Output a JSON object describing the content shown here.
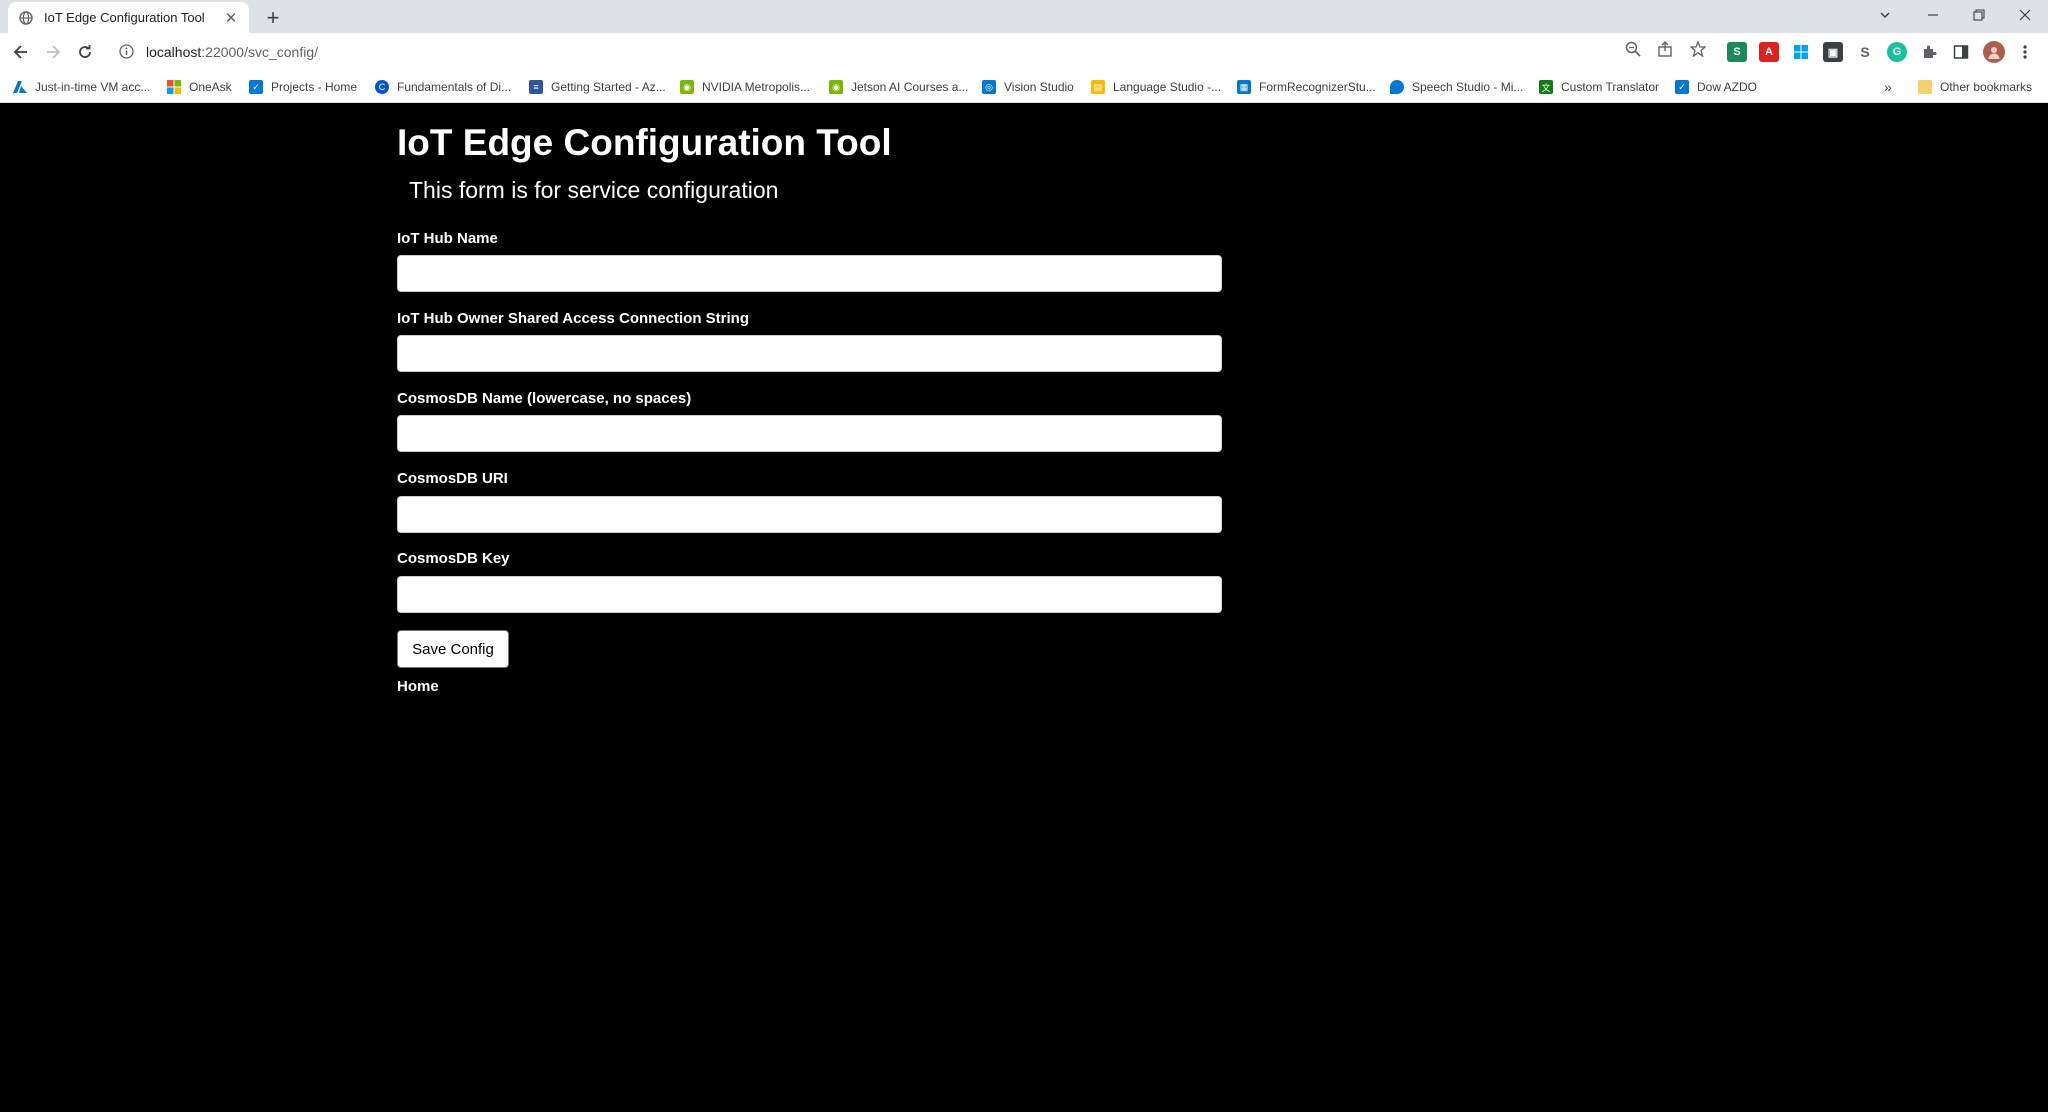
{
  "browser": {
    "tab": {
      "title": "IoT Edge Configuration Tool"
    },
    "url": {
      "host": "localhost",
      "path": ":22000/svc_config/"
    },
    "bookmarks": [
      {
        "label": "Just-in-time VM acc...",
        "icon": "azure-icon",
        "color": "#0078d4"
      },
      {
        "label": "OneAsk",
        "icon": "microsoft-icon",
        "color": "#f25022"
      },
      {
        "label": "Projects - Home",
        "icon": "azure-devops-icon",
        "color": "#0078d4"
      },
      {
        "label": "Fundamentals of Di...",
        "icon": "coursera-icon",
        "color": "#0056d2"
      },
      {
        "label": "Getting Started - Az...",
        "icon": "docs-icon",
        "color": "#2b579a"
      },
      {
        "label": "NVIDIA Metropolis...",
        "icon": "nvidia-icon",
        "color": "#76b900"
      },
      {
        "label": "Jetson AI Courses a...",
        "icon": "nvidia-icon",
        "color": "#76b900"
      },
      {
        "label": "Vision Studio",
        "icon": "vision-studio-icon",
        "color": "#0078d4"
      },
      {
        "label": "Language Studio -...",
        "icon": "language-studio-icon",
        "color": "#ffb900"
      },
      {
        "label": "FormRecognizerStu...",
        "icon": "form-recognizer-icon",
        "color": "#0078d4"
      },
      {
        "label": "Speech Studio - Mi...",
        "icon": "speech-studio-icon",
        "color": "#0078d4"
      },
      {
        "label": "Custom Translator",
        "icon": "translator-icon",
        "color": "#107c10"
      },
      {
        "label": "Dow AZDO",
        "icon": "azure-devops-icon",
        "color": "#0078d4"
      }
    ],
    "other_bookmarks": "Other bookmarks",
    "overflow": "»"
  },
  "page": {
    "title": "IoT Edge Configuration Tool",
    "subtitle": "This form is for service configuration",
    "fields": [
      {
        "label": "IoT Hub Name",
        "value": ""
      },
      {
        "label": "IoT Hub Owner Shared Access Connection String",
        "value": ""
      },
      {
        "label": "CosmosDB Name (lowercase, no spaces)",
        "value": ""
      },
      {
        "label": "CosmosDB URI",
        "value": ""
      },
      {
        "label": "CosmosDB Key",
        "value": ""
      }
    ],
    "save_button": "Save Config",
    "home_link": "Home"
  }
}
